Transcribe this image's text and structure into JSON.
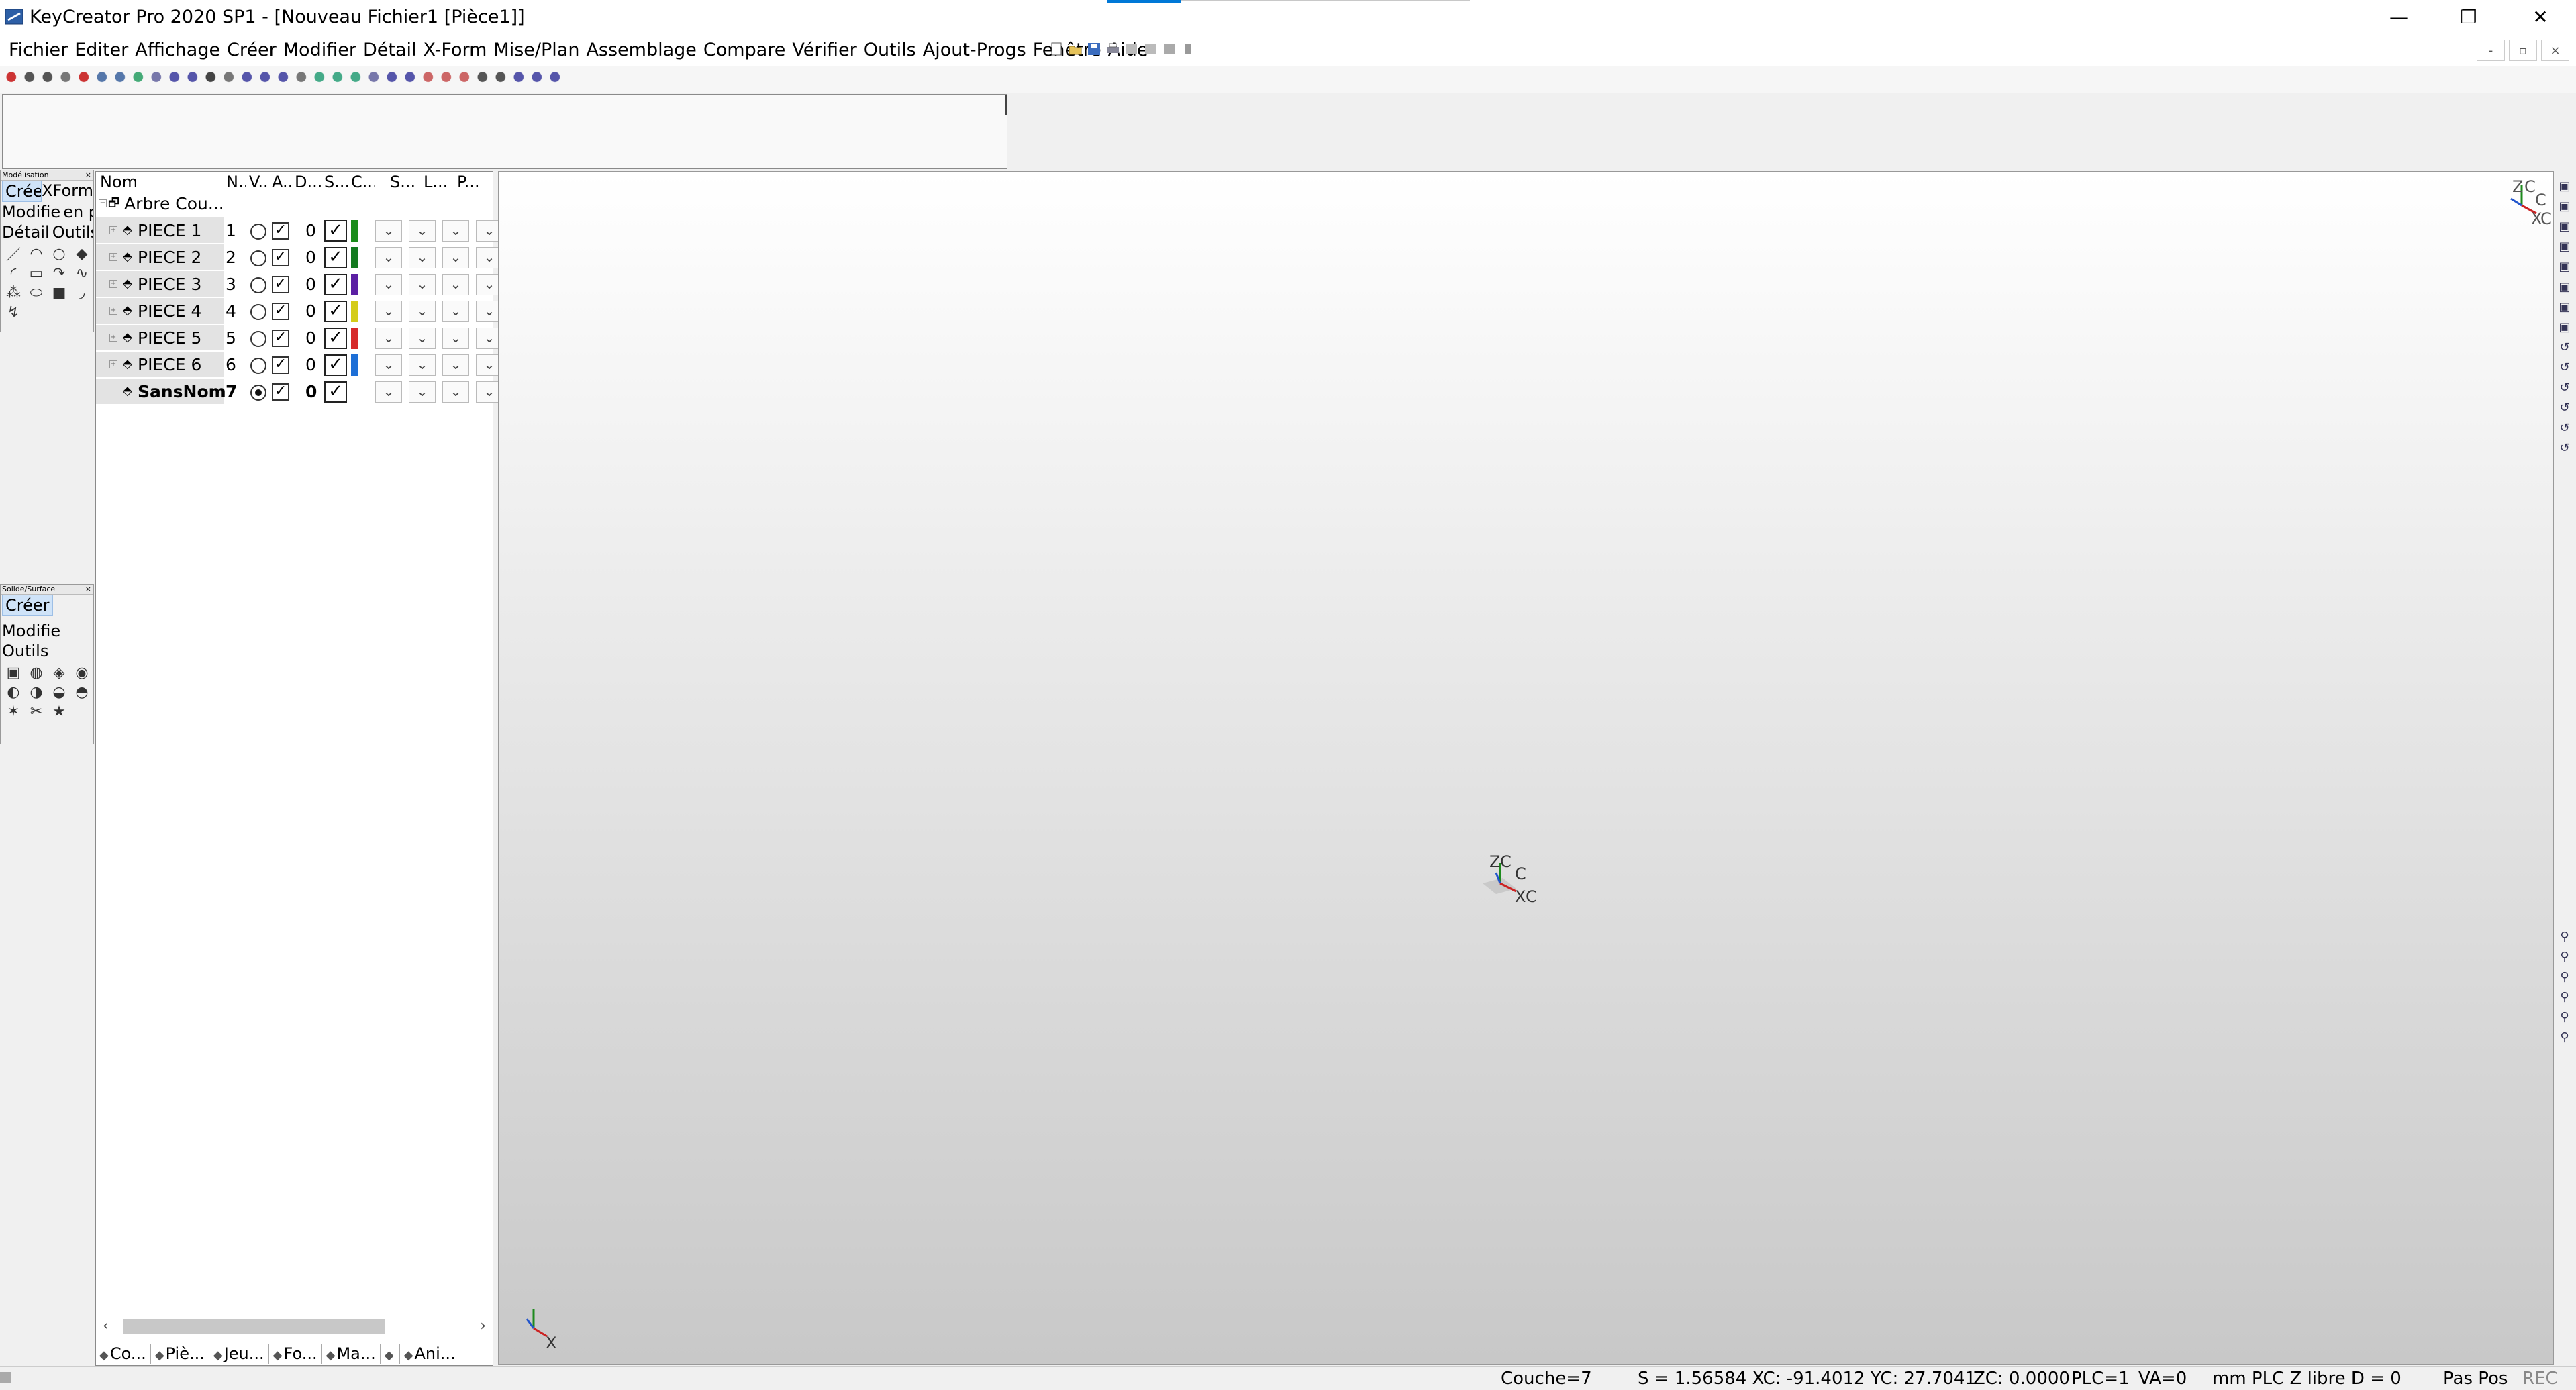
{
  "window": {
    "title": "KeyCreator Pro 2020 SP1 - [Nouveau Fichier1 [Pièce1]]",
    "minimize_glyph": "—",
    "restore_glyph": "❐",
    "close_glyph": "✕"
  },
  "menu": {
    "items": [
      "Fichier",
      "Editer",
      "Affichage",
      "Créer",
      "Modifier",
      "Détail",
      "X-Form",
      "Mise/Plan",
      "Assemblage",
      "Compare",
      "Vérifier",
      "Outils",
      "Ajout-Progs",
      "Fenêtre",
      "Aide"
    ]
  },
  "mdi_buttons": [
    "-",
    "▫",
    "×"
  ],
  "palette_modelisation": {
    "title": "Modélisation",
    "tabs": [
      "Créer",
      "XForm"
    ],
    "rows": [
      "Modifie",
      "en p",
      "Détail",
      "Outils"
    ]
  },
  "palette_solide": {
    "title": "Solide/Surface",
    "tabs": [
      "Créer",
      "Modifie",
      "Outils"
    ]
  },
  "tree": {
    "headers": [
      "Nom",
      "N...",
      "V...",
      "A...",
      "D...",
      "S...",
      "C...",
      "S...",
      "L...",
      "P..."
    ],
    "root_label": "Arbre Cou...",
    "rows": [
      {
        "name": "PIECE 1",
        "num": "1",
        "layer": "0",
        "color": "#1a8c1a",
        "active": false,
        "bold": false
      },
      {
        "name": "PIECE 2",
        "num": "2",
        "layer": "0",
        "color": "#137a1f",
        "active": false,
        "bold": false
      },
      {
        "name": "PIECE 3",
        "num": "3",
        "layer": "0",
        "color": "#5b1fa3",
        "active": false,
        "bold": false
      },
      {
        "name": "PIECE 4",
        "num": "4",
        "layer": "0",
        "color": "#d4cc1a",
        "active": false,
        "bold": false
      },
      {
        "name": "PIECE 5",
        "num": "5",
        "layer": "0",
        "color": "#d62a2a",
        "active": false,
        "bold": false
      },
      {
        "name": "PIECE 6",
        "num": "6",
        "layer": "0",
        "color": "#1e6fd6",
        "active": false,
        "bold": false
      },
      {
        "name": "SansNom",
        "num": "7",
        "layer": "0",
        "color": "#ffffff",
        "active": true,
        "bold": true
      }
    ],
    "bottom_tabs": [
      "Co...",
      "Piè...",
      "Jeu...",
      "Fo...",
      "Ma...",
      "",
      "Ani..."
    ]
  },
  "viewport": {
    "axis_labels_center": [
      "Z",
      "C",
      "C",
      "X",
      "C"
    ],
    "axis_labels_corner": [
      "Z",
      "C",
      "C",
      "X",
      "C"
    ],
    "axis_labels_bottom": [
      "X"
    ]
  },
  "status": {
    "couche": "Couche=7",
    "coords": "S = 1.56584 XC: -91.4012 YC: 27.7041",
    "zc": "ZC: 0.0000",
    "plc": "PLC=1",
    "va": "VA=0",
    "mode": "mm PLC Z libre D = 0",
    "pas_pos": "Pas Pos",
    "rec": "REC"
  }
}
